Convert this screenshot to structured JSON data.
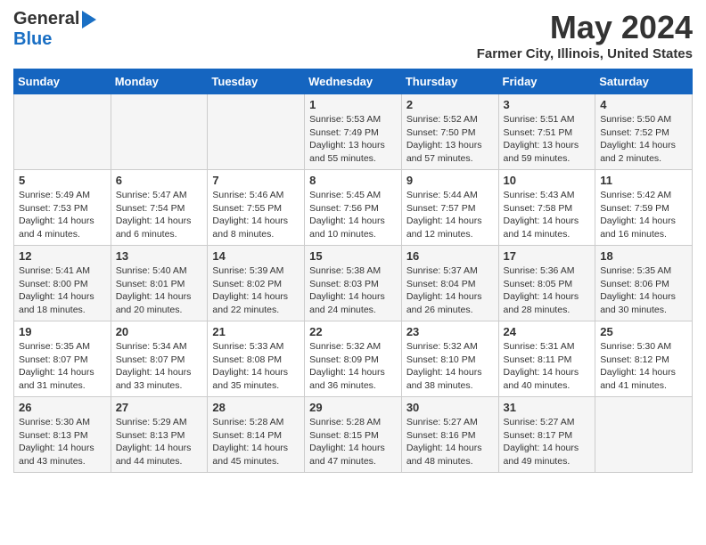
{
  "header": {
    "logo_line1": "General",
    "logo_line2": "Blue",
    "month": "May 2024",
    "location": "Farmer City, Illinois, United States"
  },
  "weekdays": [
    "Sunday",
    "Monday",
    "Tuesday",
    "Wednesday",
    "Thursday",
    "Friday",
    "Saturday"
  ],
  "weeks": [
    [
      {
        "day": "",
        "info": ""
      },
      {
        "day": "",
        "info": ""
      },
      {
        "day": "",
        "info": ""
      },
      {
        "day": "1",
        "info": "Sunrise: 5:53 AM\nSunset: 7:49 PM\nDaylight: 13 hours\nand 55 minutes."
      },
      {
        "day": "2",
        "info": "Sunrise: 5:52 AM\nSunset: 7:50 PM\nDaylight: 13 hours\nand 57 minutes."
      },
      {
        "day": "3",
        "info": "Sunrise: 5:51 AM\nSunset: 7:51 PM\nDaylight: 13 hours\nand 59 minutes."
      },
      {
        "day": "4",
        "info": "Sunrise: 5:50 AM\nSunset: 7:52 PM\nDaylight: 14 hours\nand 2 minutes."
      }
    ],
    [
      {
        "day": "5",
        "info": "Sunrise: 5:49 AM\nSunset: 7:53 PM\nDaylight: 14 hours\nand 4 minutes."
      },
      {
        "day": "6",
        "info": "Sunrise: 5:47 AM\nSunset: 7:54 PM\nDaylight: 14 hours\nand 6 minutes."
      },
      {
        "day": "7",
        "info": "Sunrise: 5:46 AM\nSunset: 7:55 PM\nDaylight: 14 hours\nand 8 minutes."
      },
      {
        "day": "8",
        "info": "Sunrise: 5:45 AM\nSunset: 7:56 PM\nDaylight: 14 hours\nand 10 minutes."
      },
      {
        "day": "9",
        "info": "Sunrise: 5:44 AM\nSunset: 7:57 PM\nDaylight: 14 hours\nand 12 minutes."
      },
      {
        "day": "10",
        "info": "Sunrise: 5:43 AM\nSunset: 7:58 PM\nDaylight: 14 hours\nand 14 minutes."
      },
      {
        "day": "11",
        "info": "Sunrise: 5:42 AM\nSunset: 7:59 PM\nDaylight: 14 hours\nand 16 minutes."
      }
    ],
    [
      {
        "day": "12",
        "info": "Sunrise: 5:41 AM\nSunset: 8:00 PM\nDaylight: 14 hours\nand 18 minutes."
      },
      {
        "day": "13",
        "info": "Sunrise: 5:40 AM\nSunset: 8:01 PM\nDaylight: 14 hours\nand 20 minutes."
      },
      {
        "day": "14",
        "info": "Sunrise: 5:39 AM\nSunset: 8:02 PM\nDaylight: 14 hours\nand 22 minutes."
      },
      {
        "day": "15",
        "info": "Sunrise: 5:38 AM\nSunset: 8:03 PM\nDaylight: 14 hours\nand 24 minutes."
      },
      {
        "day": "16",
        "info": "Sunrise: 5:37 AM\nSunset: 8:04 PM\nDaylight: 14 hours\nand 26 minutes."
      },
      {
        "day": "17",
        "info": "Sunrise: 5:36 AM\nSunset: 8:05 PM\nDaylight: 14 hours\nand 28 minutes."
      },
      {
        "day": "18",
        "info": "Sunrise: 5:35 AM\nSunset: 8:06 PM\nDaylight: 14 hours\nand 30 minutes."
      }
    ],
    [
      {
        "day": "19",
        "info": "Sunrise: 5:35 AM\nSunset: 8:07 PM\nDaylight: 14 hours\nand 31 minutes."
      },
      {
        "day": "20",
        "info": "Sunrise: 5:34 AM\nSunset: 8:07 PM\nDaylight: 14 hours\nand 33 minutes."
      },
      {
        "day": "21",
        "info": "Sunrise: 5:33 AM\nSunset: 8:08 PM\nDaylight: 14 hours\nand 35 minutes."
      },
      {
        "day": "22",
        "info": "Sunrise: 5:32 AM\nSunset: 8:09 PM\nDaylight: 14 hours\nand 36 minutes."
      },
      {
        "day": "23",
        "info": "Sunrise: 5:32 AM\nSunset: 8:10 PM\nDaylight: 14 hours\nand 38 minutes."
      },
      {
        "day": "24",
        "info": "Sunrise: 5:31 AM\nSunset: 8:11 PM\nDaylight: 14 hours\nand 40 minutes."
      },
      {
        "day": "25",
        "info": "Sunrise: 5:30 AM\nSunset: 8:12 PM\nDaylight: 14 hours\nand 41 minutes."
      }
    ],
    [
      {
        "day": "26",
        "info": "Sunrise: 5:30 AM\nSunset: 8:13 PM\nDaylight: 14 hours\nand 43 minutes."
      },
      {
        "day": "27",
        "info": "Sunrise: 5:29 AM\nSunset: 8:13 PM\nDaylight: 14 hours\nand 44 minutes."
      },
      {
        "day": "28",
        "info": "Sunrise: 5:28 AM\nSunset: 8:14 PM\nDaylight: 14 hours\nand 45 minutes."
      },
      {
        "day": "29",
        "info": "Sunrise: 5:28 AM\nSunset: 8:15 PM\nDaylight: 14 hours\nand 47 minutes."
      },
      {
        "day": "30",
        "info": "Sunrise: 5:27 AM\nSunset: 8:16 PM\nDaylight: 14 hours\nand 48 minutes."
      },
      {
        "day": "31",
        "info": "Sunrise: 5:27 AM\nSunset: 8:17 PM\nDaylight: 14 hours\nand 49 minutes."
      },
      {
        "day": "",
        "info": ""
      }
    ]
  ]
}
